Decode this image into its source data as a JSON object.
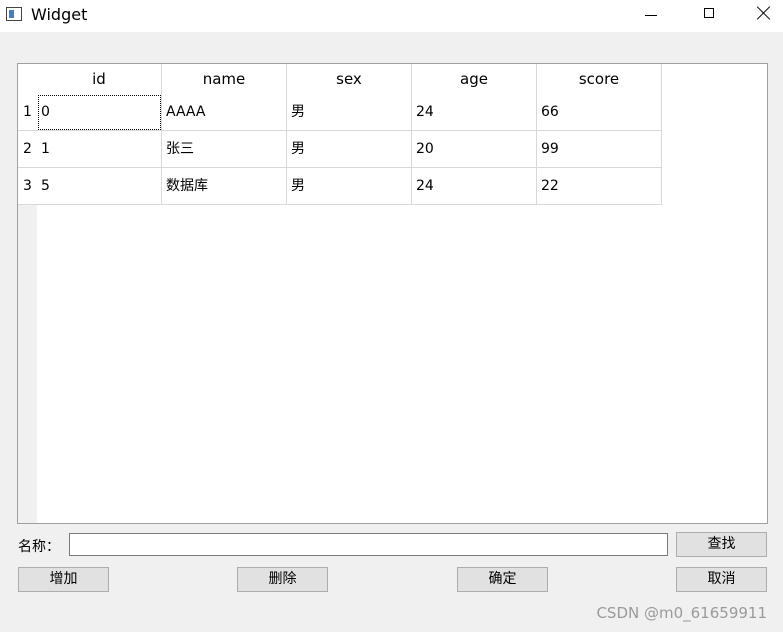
{
  "window": {
    "title": "Widget"
  },
  "table": {
    "columns": [
      "id",
      "name",
      "sex",
      "age",
      "score"
    ],
    "row_labels": [
      "1",
      "2",
      "3"
    ],
    "rows": [
      [
        "0",
        "AAAA",
        "男",
        "24",
        "66"
      ],
      [
        "1",
        "张三",
        "男",
        "20",
        "99"
      ],
      [
        "5",
        "数据库",
        "男",
        "24",
        "22"
      ]
    ]
  },
  "search": {
    "label": "名称：",
    "value": "",
    "button_label": "查找"
  },
  "actions": {
    "add_label": "增加",
    "delete_label": "删除",
    "confirm_label": "确定",
    "cancel_label": "取消"
  },
  "watermark": "CSDN @m0_61659911"
}
